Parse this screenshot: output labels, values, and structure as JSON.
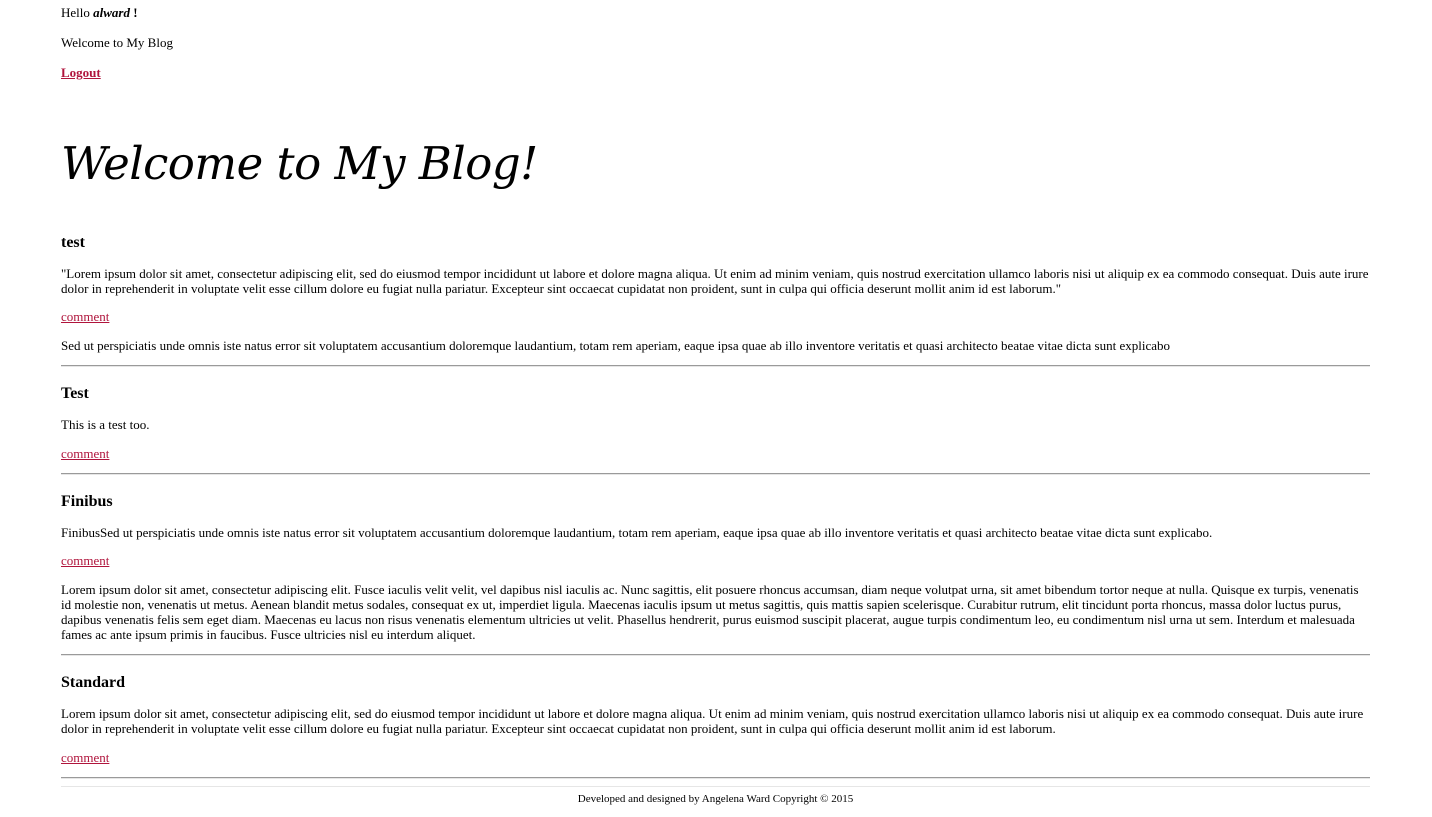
{
  "header": {
    "hello_prefix": "Hello ",
    "username": "alward",
    "hello_suffix": " !",
    "welcome_line": "Welcome to My Blog",
    "logout_label": "Logout"
  },
  "blog_title": "Welcome to My Blog!",
  "posts": [
    {
      "title": "test",
      "body": "\"Lorem ipsum dolor sit amet, consectetur adipiscing elit, sed do eiusmod tempor incididunt ut labore et dolore magna aliqua. Ut enim ad minim veniam, quis nostrud exercitation ullamco laboris nisi ut aliquip ex ea commodo consequat. Duis aute irure dolor in reprehenderit in voluptate velit esse cillum dolore eu fugiat nulla pariatur. Excepteur sint occaecat cupidatat non proident, sunt in culpa qui officia deserunt mollit anim id est laborum.\"",
      "comment_label": "comment",
      "comment_text": "Sed ut perspiciatis unde omnis iste natus error sit voluptatem accusantium doloremque laudantium, totam rem aperiam, eaque ipsa quae ab illo inventore veritatis et quasi architecto beatae vitae dicta sunt explicabo"
    },
    {
      "title": "Test",
      "body": "This is a test too.",
      "comment_label": "comment",
      "comment_text": ""
    },
    {
      "title": "Finibus",
      "body": "FinibusSed ut perspiciatis unde omnis iste natus error sit voluptatem accusantium doloremque laudantium, totam rem aperiam, eaque ipsa quae ab illo inventore veritatis et quasi architecto beatae vitae dicta sunt explicabo.",
      "comment_label": "comment",
      "comment_text": "Lorem ipsum dolor sit amet, consectetur adipiscing elit. Fusce iaculis velit velit, vel dapibus nisl iaculis ac. Nunc sagittis, elit posuere rhoncus accumsan, diam neque volutpat urna, sit amet bibendum tortor neque at nulla. Quisque ex turpis, venenatis id molestie non, venenatis ut metus. Aenean blandit metus sodales, consequat ex ut, imperdiet ligula. Maecenas iaculis ipsum ut metus sagittis, quis mattis sapien scelerisque. Curabitur rutrum, elit tincidunt porta rhoncus, massa dolor luctus purus, dapibus venenatis felis sem eget diam. Maecenas eu lacus non risus venenatis elementum ultricies ut velit. Phasellus hendrerit, purus euismod suscipit placerat, augue turpis condimentum leo, eu condimentum nisl urna ut sem. Interdum et malesuada fames ac ante ipsum primis in faucibus. Fusce ultricies nisl eu interdum aliquet."
    },
    {
      "title": "Standard",
      "body": "Lorem ipsum dolor sit amet, consectetur adipiscing elit, sed do eiusmod tempor incididunt ut labore et dolore magna aliqua. Ut enim ad minim veniam, quis nostrud exercitation ullamco laboris nisi ut aliquip ex ea commodo consequat. Duis aute irure dolor in reprehenderit in voluptate velit esse cillum dolore eu fugiat nulla pariatur. Excepteur sint occaecat cupidatat non proident, sunt in culpa qui officia deserunt mollit anim id est laborum.",
      "comment_label": "comment",
      "comment_text": ""
    }
  ],
  "footer": {
    "text": "Developed and designed by Angelena Ward Copyright © 2015"
  },
  "colors": {
    "link": "#b0143c",
    "divider": "#9a9a9a"
  }
}
